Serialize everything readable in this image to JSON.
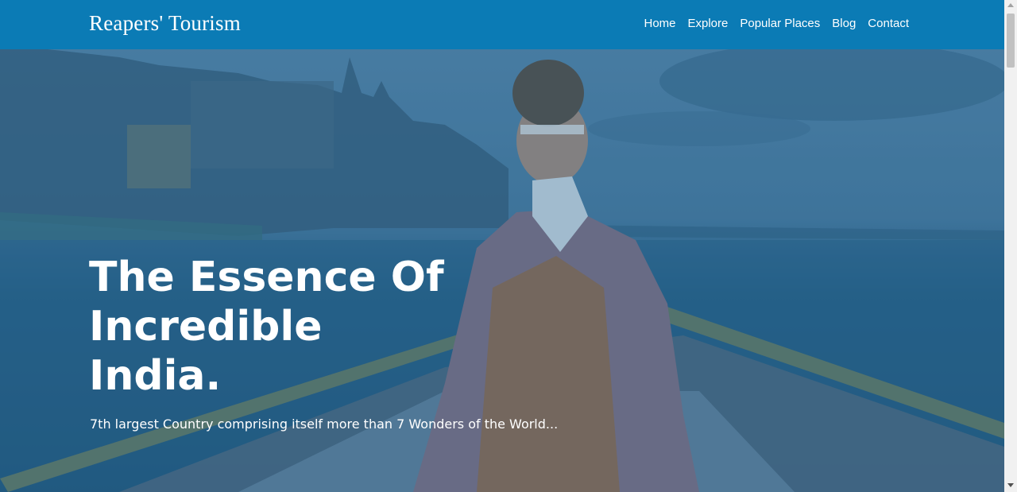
{
  "navbar": {
    "brand": "Reapers' Tourism",
    "links": [
      "Home",
      "Explore",
      "Popular Places",
      "Blog",
      "Contact"
    ]
  },
  "hero": {
    "title_lines": [
      "The Essence Of",
      "Incredible",
      "India."
    ],
    "subtitle": "7th largest Country comprising itself more than 7 Wonders of the World..."
  },
  "colors": {
    "navbar": "#0b7bb5",
    "text": "#ffffff",
    "overlay": "#126096"
  }
}
